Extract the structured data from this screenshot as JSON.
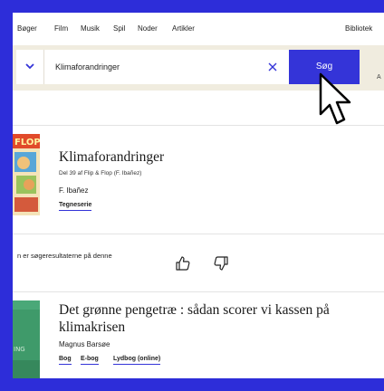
{
  "nav": {
    "links": [
      "Bøger",
      "Film",
      "Musik",
      "Spil",
      "Noder",
      "Artikler"
    ],
    "right": "Bibliotek"
  },
  "search": {
    "query": "Klimaforandringer",
    "button": "Søg",
    "advanced_fragment": "A"
  },
  "results": [
    {
      "title": "Klimaforandringer",
      "series": "Del 39 af Flip & Flop (F. Ibañez)",
      "author": "F. Ibañez",
      "tags": [
        "Tegneserie"
      ]
    },
    {
      "title": "Det grønne pengetræ : sådan scorer vi kassen på klimakrisen",
      "author": "Magnus Barsøe",
      "tags": [
        "Bog",
        "E-bog",
        "Lydbog (online)"
      ]
    }
  ],
  "feedback": {
    "text": "n er søgeresultaterne på denne"
  },
  "colors": {
    "accent": "#3434d8",
    "search_bar_bg": "#f0ecdf",
    "frame": "#2d2dd9"
  },
  "icons": {
    "thumb_up": "thumbs-up-icon",
    "thumb_down": "thumbs-down-icon",
    "clear": "close-icon",
    "dropdown": "chevron-down-icon",
    "cursor": "mouse-pointer-icon"
  }
}
